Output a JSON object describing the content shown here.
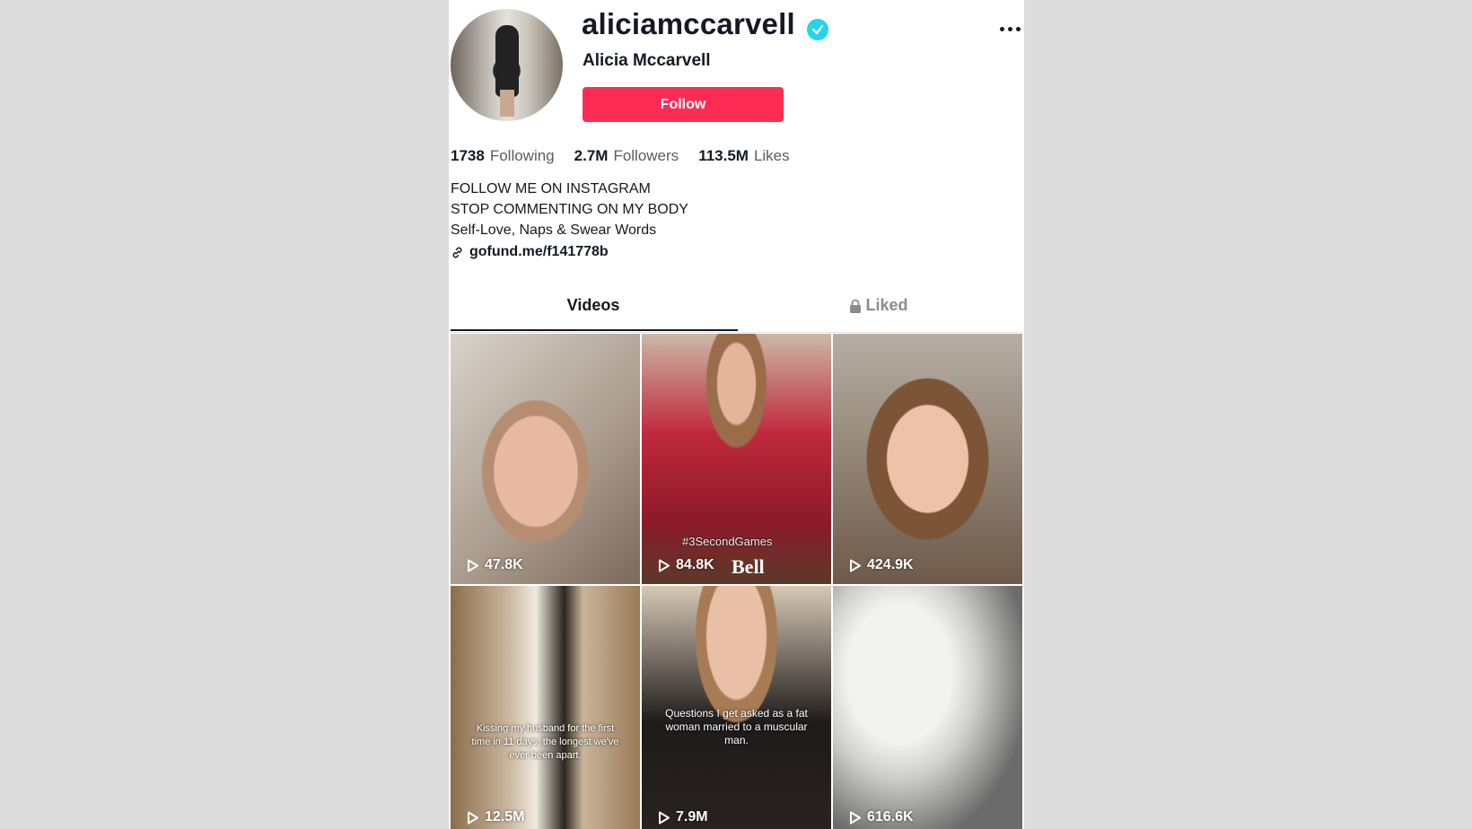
{
  "profile": {
    "username": "aliciamccarvell",
    "display_name": "Alicia Mccarvell",
    "follow_label": "Follow",
    "stats": [
      {
        "value": "1738",
        "label": "Following"
      },
      {
        "value": "2.7M",
        "label": "Followers"
      },
      {
        "value": "113.5M",
        "label": "Likes"
      }
    ],
    "bio": [
      "FOLLOW ME ON INSTAGRAM",
      "STOP COMMENTING ON MY BODY",
      "Self-Love, Naps & Swear Words"
    ],
    "link": "gofund.me/f141778b"
  },
  "tabs": {
    "videos": "Videos",
    "liked": "Liked"
  },
  "videos": [
    {
      "views": "47.8K"
    },
    {
      "views": "84.8K",
      "tag": "#3SecondGames",
      "brand": "Bell"
    },
    {
      "views": "424.9K"
    },
    {
      "views": "12.5M",
      "caption": "Kissing my husband for the first time in 11 days, the longest we've ever been apart."
    },
    {
      "views": "7.9M",
      "caption": "Questions I get asked as a fat woman married to a muscular man."
    },
    {
      "views": "616.6K"
    }
  ],
  "colors": {
    "follow": "#fe2c55",
    "verified": "#20d5ec"
  }
}
